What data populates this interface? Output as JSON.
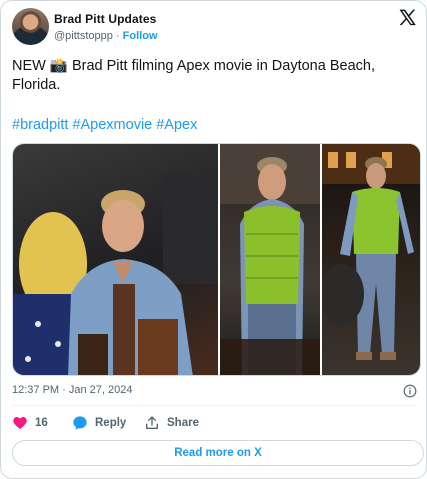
{
  "author": {
    "display_name": "Brad Pitt Updates",
    "handle": "@pittstoppp",
    "separator": "·",
    "follow_label": "Follow"
  },
  "tweet": {
    "text": "NEW 📸 Brad Pitt filming Apex movie in Daytona Beach, Florida.",
    "hashtags": [
      "#bradpitt",
      "#Apexmovie",
      "#Apex"
    ]
  },
  "meta": {
    "time": "12:37 PM",
    "separator": "·",
    "date": "Jan 27, 2024"
  },
  "actions": {
    "like_count": "16",
    "reply_label": "Reply",
    "share_label": "Share"
  },
  "read_more_label": "Read more on X",
  "icons": {
    "brand": "x-logo-icon",
    "info": "info-icon",
    "like": "heart-icon",
    "reply": "reply-bubble-icon",
    "share": "share-upload-icon"
  },
  "colors": {
    "accent": "#1d9bf0",
    "like": "#f91880",
    "text": "#0f1419",
    "muted": "#536471",
    "border": "#cfd9de"
  }
}
